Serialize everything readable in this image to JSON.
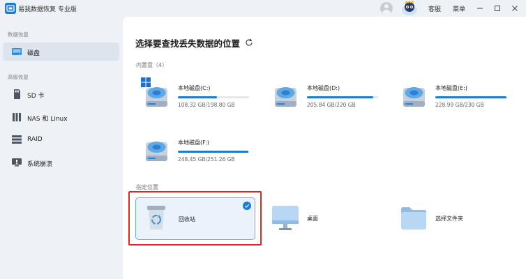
{
  "app": {
    "title": "易我数据恢复 专业版"
  },
  "titlebar": {
    "support_label": "客服",
    "menu_label": "菜单"
  },
  "sidebar": {
    "data_recovery_label": "数据恢复",
    "advanced_recovery_label": "高级恢复",
    "items": [
      {
        "label": "磁盘",
        "icon": "disk-icon",
        "active": true
      },
      {
        "label": "SD 卡",
        "icon": "sd-card-icon"
      },
      {
        "label": "NAS 和 Linux",
        "icon": "nas-icon"
      },
      {
        "label": "RAID",
        "icon": "raid-icon"
      },
      {
        "label": "系统崩溃",
        "icon": "system-crash-icon"
      }
    ]
  },
  "main": {
    "title": "选择要查找丢失数据的位置",
    "internal_label": "内置盘（4）",
    "drives": [
      {
        "name": "本地磁盘(C:)",
        "size": "108.32 GB/198.80 GB",
        "used_fraction": 0.545,
        "windows_badge": true
      },
      {
        "name": "本地磁盘(D:)",
        "size": "205.84 GB/220 GB",
        "used_fraction": 0.936
      },
      {
        "name": "本地磁盘(E:)",
        "size": "228.99 GB/230 GB",
        "used_fraction": 0.996
      },
      {
        "name": "本地磁盘(F:)",
        "size": "248.45 GB/251.26 GB",
        "used_fraction": 0.989
      }
    ],
    "location_label": "指定位置",
    "locations": [
      {
        "name": "回收站",
        "icon": "recycle-bin-icon",
        "selected": true
      },
      {
        "name": "桌面",
        "icon": "desktop-icon"
      },
      {
        "name": "选择文件夹",
        "icon": "folder-icon"
      }
    ]
  },
  "colors": {
    "accent": "#1a7bd8",
    "highlight_border": "#e0262a"
  }
}
